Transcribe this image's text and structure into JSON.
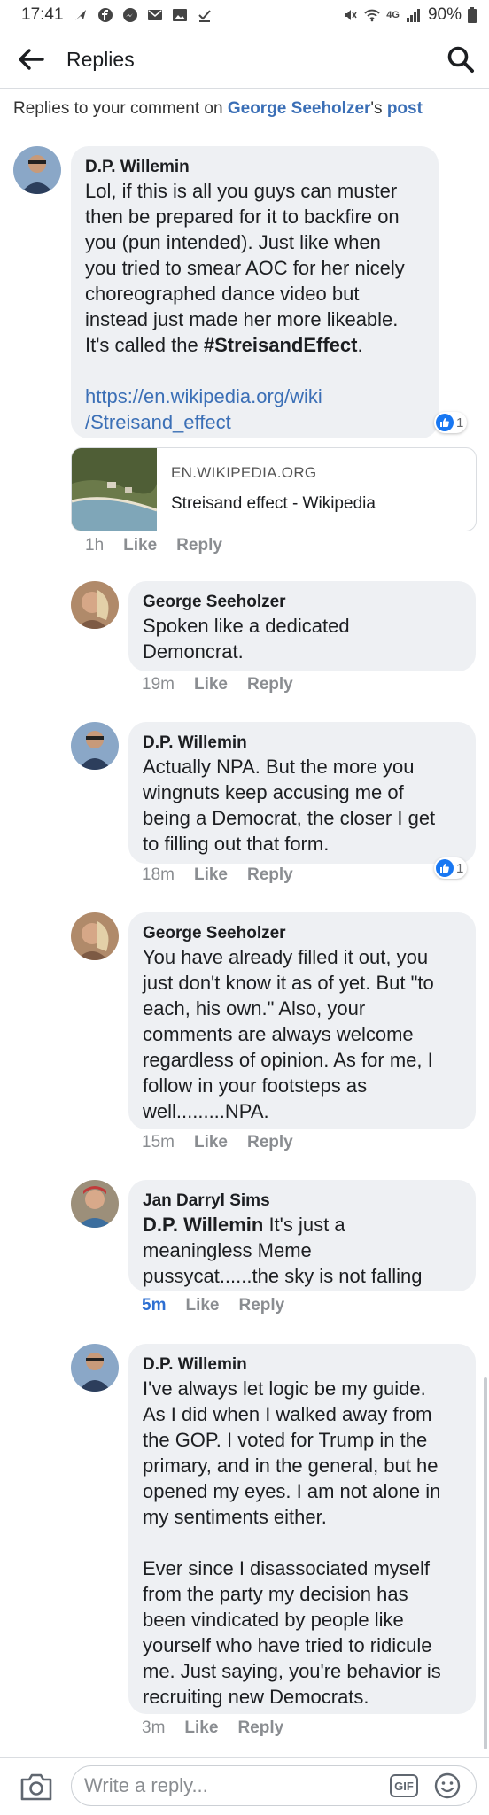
{
  "status_bar": {
    "time": "17:41",
    "network": "4G",
    "battery": "90%"
  },
  "header": {
    "title": "Replies"
  },
  "context": {
    "prefix": "Replies to your comment on ",
    "author": "George Seeholzer",
    "possessive": "'s ",
    "post_link": "post"
  },
  "comments": [
    {
      "author": "D.P. Willemin",
      "text": "Lol, if this is all you guys can muster\nthen be prepared for it to backfire on\nyou (pun intended). Just like when\nyou tried to smear AOC for her nicely\nchoreographed dance video but\ninstead just made her more likeable.\nIt's called the ",
      "hashtag": "#StreisandEffect",
      "text_end": ".",
      "link": "https://en.wikipedia.org/wiki\n/Streisand_effect",
      "time": "1h",
      "like": "Like",
      "reply": "Reply",
      "reactions": "1"
    },
    {
      "author": "George Seeholzer",
      "text": "Spoken like a dedicated\nDemoncrat.",
      "time": "19m",
      "like": "Like",
      "reply": "Reply"
    },
    {
      "author": "D.P. Willemin",
      "text": "Actually NPA. But the more you\nwingnuts keep accusing me of\nbeing a Democrat, the closer I get\nto filling out that form.",
      "time": "18m",
      "like": "Like",
      "reply": "Reply",
      "reactions": "1"
    },
    {
      "author": "George Seeholzer",
      "text": "You have already filled it out, you\njust don't know it as of yet. But \"to\neach, his own.\" Also, your\ncomments are always welcome\nregardless of opinion. As for me, I\nfollow in your footsteps as\nwell.........NPA.",
      "time": "15m",
      "like": "Like",
      "reply": "Reply"
    },
    {
      "author": "Jan Darryl Sims",
      "mention": "D.P. Willemin",
      "text": " It's just a\nmeaningless Meme\npussycat......the sky is not falling",
      "time": "5m",
      "like": "Like",
      "reply": "Reply"
    },
    {
      "author": "D.P. Willemin",
      "text": "I've always let logic be my guide.\nAs I did when I walked away from\nthe GOP. I voted for Trump in the\nprimary, and in the general, but he\nopened my eyes. I am not alone in\nmy sentiments either.\n\nEver since I disassociated myself\nfrom the party my decision has\nbeen vindicated by people like\nyourself who have tried to ridicule\nme. Just saying, you're behavior is\nrecruiting new Democrats.",
      "time": "3m",
      "like": "Like",
      "reply": "Reply"
    }
  ],
  "link_preview": {
    "domain": "EN.WIKIPEDIA.ORG",
    "title": "Streisand effect - Wikipedia"
  },
  "composer": {
    "placeholder": "Write a reply...",
    "gif_label": "GIF"
  },
  "colors": {
    "accent": "#3b6fb6",
    "bubble": "#eef0f3",
    "meta": "#8a8d91",
    "like_blue": "#1877f2"
  }
}
